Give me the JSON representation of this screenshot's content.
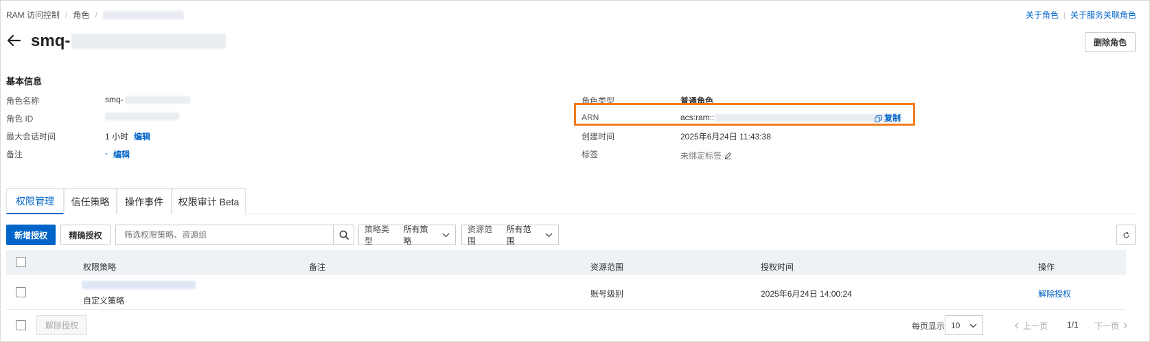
{
  "breadcrumb": {
    "items": [
      "RAM 访问控制",
      "角色"
    ],
    "separator": "/"
  },
  "top_links": {
    "about_role": "关于角色",
    "separator": "|",
    "about_service_role": "关于服务关联角色"
  },
  "header": {
    "title_prefix": "smq-",
    "delete_label": "删除角色"
  },
  "basic_info": {
    "section_title": "基本信息",
    "role_name_label": "角色名称",
    "role_name_prefix": "smq-",
    "role_id_label": "角色 ID",
    "max_session_label": "最大会话时间",
    "max_session_value": "1 小时",
    "edit_label": "编辑",
    "note_label": "备注",
    "note_value": "-",
    "role_type_label": "角色类型",
    "role_type_value": "普通角色",
    "arn_label": "ARN",
    "arn_prefix": "acs:ram::",
    "copy_label": "复制",
    "created_label": "创建时间",
    "created_value": "2025年6月24日 11:43:38",
    "tags_label": "标签",
    "tags_value": "未绑定标签"
  },
  "tabs": [
    {
      "label": "权限管理",
      "active": true
    },
    {
      "label": "信任策略",
      "active": false
    },
    {
      "label": "操作事件",
      "active": false
    },
    {
      "label": "权限审计 Beta",
      "active": false
    }
  ],
  "toolbar": {
    "add_grant": "新增授权",
    "precise_grant": "精确授权",
    "search_placeholder": "筛选权限策略、资源组",
    "policy_type_key": "策略类型",
    "policy_type_value": "所有策略",
    "scope_key": "资源范围",
    "scope_value": "所有范围"
  },
  "table": {
    "columns": [
      "权限策略",
      "备注",
      "资源范围",
      "授权时间",
      "操作"
    ],
    "rows": [
      {
        "policy_type": "自定义策略",
        "scope": "账号级别",
        "granted_at": "2025年6月24日 14:00:24",
        "action": "解除授权"
      }
    ]
  },
  "footer": {
    "bulk_revoke": "解除授权",
    "page_size_label": "每页显示",
    "page_size": "10",
    "prev": "上一页",
    "page_indicator": "1/1",
    "next": "下一页"
  },
  "colors": {
    "accent": "#0064c8",
    "highlight_border": "#f07c1b",
    "table_header_bg": "#eef1f6"
  }
}
